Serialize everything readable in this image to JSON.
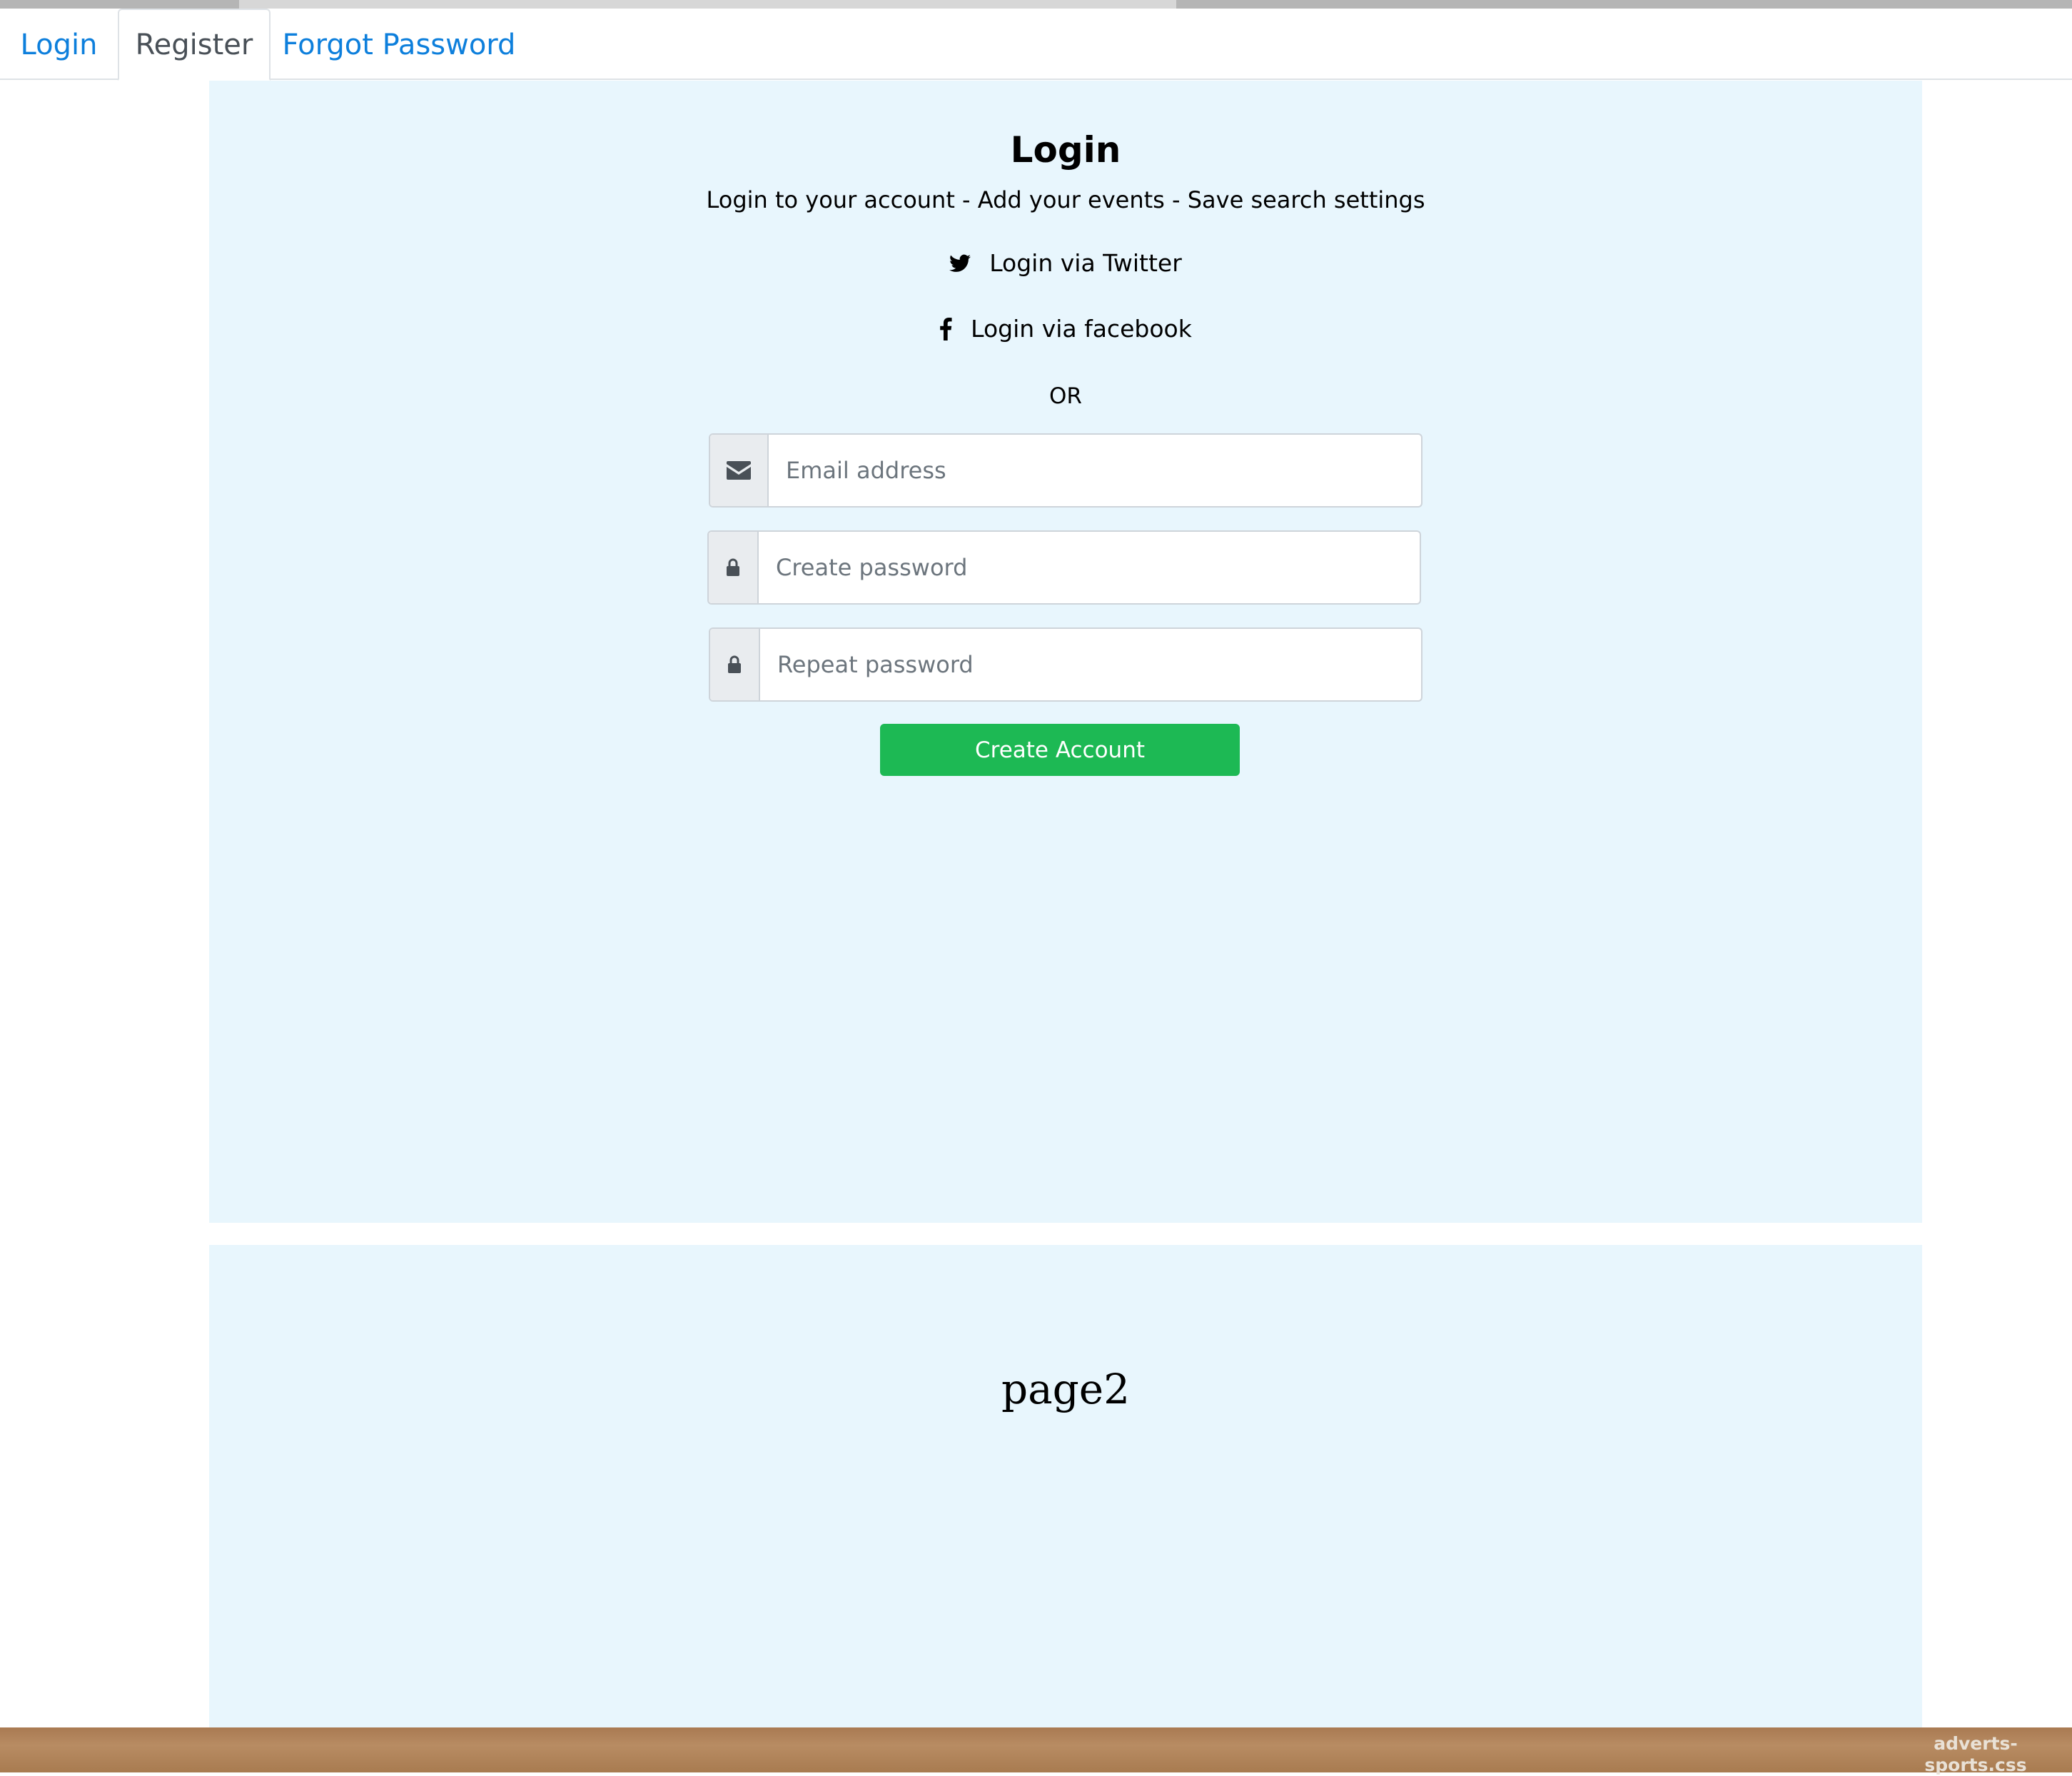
{
  "tabs": [
    {
      "label": "Login"
    },
    {
      "label": "Register",
      "active": true
    },
    {
      "label": "Forgot Password"
    }
  ],
  "panel": {
    "title": "Login",
    "subtitle": "Login to your account - Add your events - Save search settings",
    "twitter_label": "Login via Twitter",
    "facebook_label": "Login via facebook",
    "or_label": "OR",
    "email_placeholder": "Email address",
    "password_placeholder": "Create password",
    "repeat_placeholder": "Repeat password",
    "submit_label": "Create Account"
  },
  "page2": {
    "label": "page2"
  },
  "footer": {
    "ad_label": "adverts-sports.css"
  },
  "colors": {
    "link": "#0d7fdc",
    "panel_bg": "#e8f6fd",
    "button": "#1db954"
  },
  "icons": [
    "twitter-icon",
    "facebook-icon",
    "envelope-icon",
    "lock-icon"
  ]
}
